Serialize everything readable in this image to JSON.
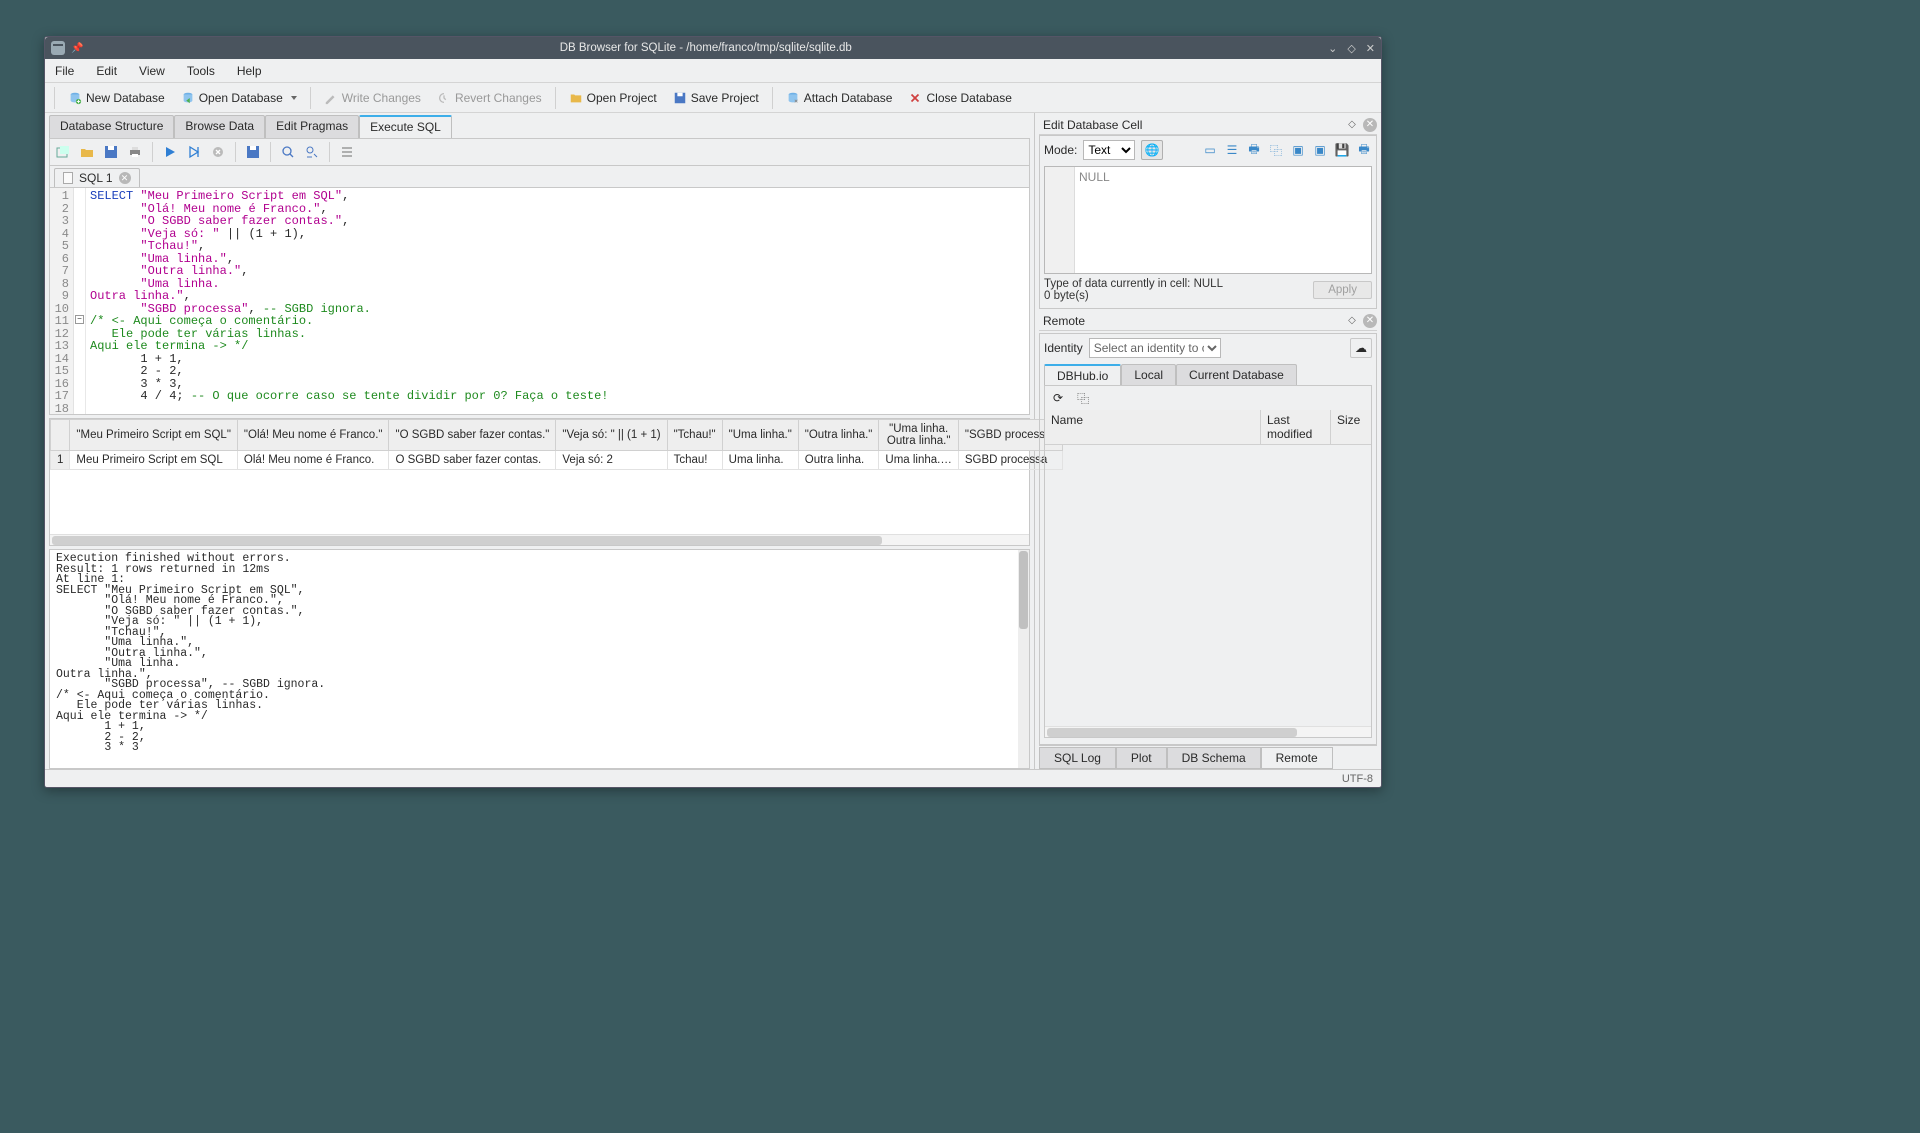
{
  "titlebar": {
    "title": "DB Browser for SQLite - /home/franco/tmp/sqlite/sqlite.db"
  },
  "menu": {
    "file": "File",
    "edit": "Edit",
    "view": "View",
    "tools": "Tools",
    "help": "Help"
  },
  "toolbar": {
    "new_db": "New Database",
    "open_db": "Open Database",
    "write": "Write Changes",
    "revert": "Revert Changes",
    "open_proj": "Open Project",
    "save_proj": "Save Project",
    "attach": "Attach Database",
    "close": "Close Database"
  },
  "main_tabs": {
    "structure": "Database Structure",
    "browse": "Browse Data",
    "pragmas": "Edit Pragmas",
    "execute": "Execute SQL"
  },
  "sql_file_tab": {
    "name": "SQL 1"
  },
  "code_lines": [
    {
      "n": 1,
      "html": "<span class='kw'>SELECT</span> <span class='str'>\"Meu Primeiro Script em SQL\"</span>,"
    },
    {
      "n": 2,
      "html": "       <span class='str'>\"Olá! Meu nome é Franco.\"</span>,"
    },
    {
      "n": 3,
      "html": "       <span class='str'>\"O SGBD saber fazer contas.\"</span>,"
    },
    {
      "n": 4,
      "html": "       <span class='str'>\"Veja só: \"</span> || (1 + 1),"
    },
    {
      "n": 5,
      "html": "       <span class='str'>\"Tchau!\"</span>,"
    },
    {
      "n": 6,
      "html": "       <span class='str'>\"Uma linha.\"</span>,"
    },
    {
      "n": 7,
      "html": "       <span class='str'>\"Outra linha.\"</span>,"
    },
    {
      "n": 8,
      "html": "       <span class='str'>\"Uma linha.</span>"
    },
    {
      "n": 9,
      "html": "<span class='str'>Outra linha.\"</span>,"
    },
    {
      "n": 10,
      "html": "       <span class='str'>\"SGBD processa\"</span>, <span class='cmt'>-- SGBD ignora.</span>"
    },
    {
      "n": 11,
      "html": "<span class='cmt'>/* &lt;- Aqui começa o comentário.</span>",
      "fold": true
    },
    {
      "n": 12,
      "html": "<span class='cmt'>   Ele pode ter várias linhas.</span>"
    },
    {
      "n": 13,
      "html": "<span class='cmt'>Aqui ele termina -&gt; */</span>"
    },
    {
      "n": 14,
      "html": "       1 + 1,"
    },
    {
      "n": 15,
      "html": "       2 - 2,"
    },
    {
      "n": 16,
      "html": "       3 * 3,"
    },
    {
      "n": 17,
      "html": "       4 / 4; <span class='cmt'>-- O que ocorre caso se tente dividir por 0? Faça o teste!</span>"
    },
    {
      "n": 18,
      "html": "",
      "cur": true
    }
  ],
  "result_headers": [
    "\"Meu Primeiro Script em SQL\"",
    "\"Olá! Meu nome é Franco.\"",
    "\"O SGBD saber fazer contas.\"",
    "\"Veja só: \" || (1 + 1)",
    "\"Tchau!\"",
    "\"Uma linha.\"",
    "\"Outra linha.\"",
    "\"Uma linha.\nOutra linha.\"",
    "\"SGBD processa\""
  ],
  "result_row": [
    "Meu Primeiro Script em SQL",
    "Olá! Meu nome é Franco.",
    "O SGBD saber fazer contas.",
    "Veja só: 2",
    "Tchau!",
    "Uma linha.",
    "Outra linha.",
    "Uma linha.…",
    "SGBD processa"
  ],
  "log_text": "Execution finished without errors.\nResult: 1 rows returned in 12ms\nAt line 1:\nSELECT \"Meu Primeiro Script em SQL\",\n       \"Olá! Meu nome é Franco.\",\n       \"O SGBD saber fazer contas.\",\n       \"Veja só: \" || (1 + 1),\n       \"Tchau!\",\n       \"Uma linha.\",\n       \"Outra linha.\",\n       \"Uma linha.\nOutra linha.\",\n       \"SGBD processa\", -- SGBD ignora.\n/* <- Aqui começa o comentário.\n   Ele pode ter várias linhas.\nAqui ele termina -> */\n       1 + 1,\n       2 - 2,\n       3 * 3",
  "cell_pane": {
    "title": "Edit Database Cell",
    "mode_label": "Mode:",
    "mode_value": "Text",
    "null_text": "NULL",
    "type_text": "Type of data currently in cell: NULL",
    "size_text": "0 byte(s)",
    "apply": "Apply"
  },
  "remote_pane": {
    "title": "Remote",
    "identity_label": "Identity",
    "identity_placeholder": "Select an identity to connect",
    "tabs": {
      "dbhub": "DBHub.io",
      "local": "Local",
      "current": "Current Database"
    },
    "columns": {
      "name": "Name",
      "modified": "Last modified",
      "size": "Size"
    }
  },
  "bottom_tabs": {
    "sqllog": "SQL Log",
    "plot": "Plot",
    "schema": "DB Schema",
    "remote": "Remote"
  },
  "status": {
    "encoding": "UTF-8"
  }
}
